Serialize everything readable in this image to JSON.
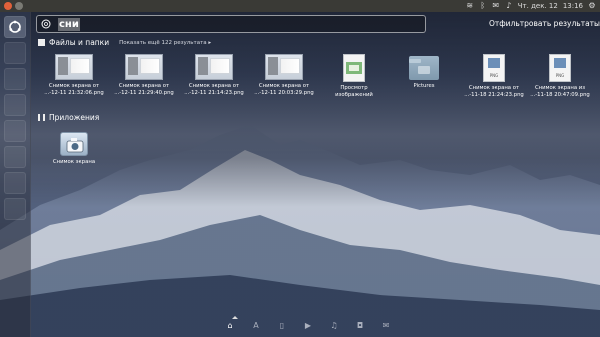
{
  "top_bar": {
    "date": "Чт. дек. 12",
    "time": "13:16"
  },
  "search": {
    "query": "сни"
  },
  "filter": {
    "label": "Отфильтровать результаты"
  },
  "files_category": {
    "title": "Файлы и папки",
    "more_label": "Показать ещё 122 результата"
  },
  "files": [
    {
      "name": "Снимок экрана от",
      "detail": "...-12-11 21:32:06.png",
      "icon": "screenshot-icon"
    },
    {
      "name": "Снимок экрана от",
      "detail": "...-12-11 21:29:40.png",
      "icon": "screenshot-icon"
    },
    {
      "name": "Снимок экрана от",
      "detail": "...-12-11 21:14:23.png",
      "icon": "screenshot-icon"
    },
    {
      "name": "Снимок экрана от",
      "detail": "...-12-11 20:03:29.png",
      "icon": "screenshot-icon"
    },
    {
      "name": "Просмотр",
      "detail": "изображений",
      "icon": "image-viewer-icon"
    },
    {
      "name": "Pictures",
      "detail": "",
      "icon": "folder-icon"
    },
    {
      "name": "Снимок экрана от",
      "detail": "...-11-18 21:24:23.png",
      "icon": "png-file-icon"
    },
    {
      "name": "Снимок экрана из",
      "detail": "...-11-18 20:47:09.png",
      "icon": "png-file-icon"
    }
  ],
  "apps_category": {
    "title": "Приложения"
  },
  "apps": [
    {
      "name": "Снимок экрана",
      "icon": "screenshot-app-icon"
    }
  ],
  "lenses": [
    "home-lens-icon",
    "applications-lens-icon",
    "files-lens-icon",
    "video-lens-icon",
    "music-lens-icon",
    "photos-lens-icon",
    "social-lens-icon"
  ],
  "colors": {
    "top_bar": "#3a3a36",
    "close_button": "#e2613a"
  }
}
